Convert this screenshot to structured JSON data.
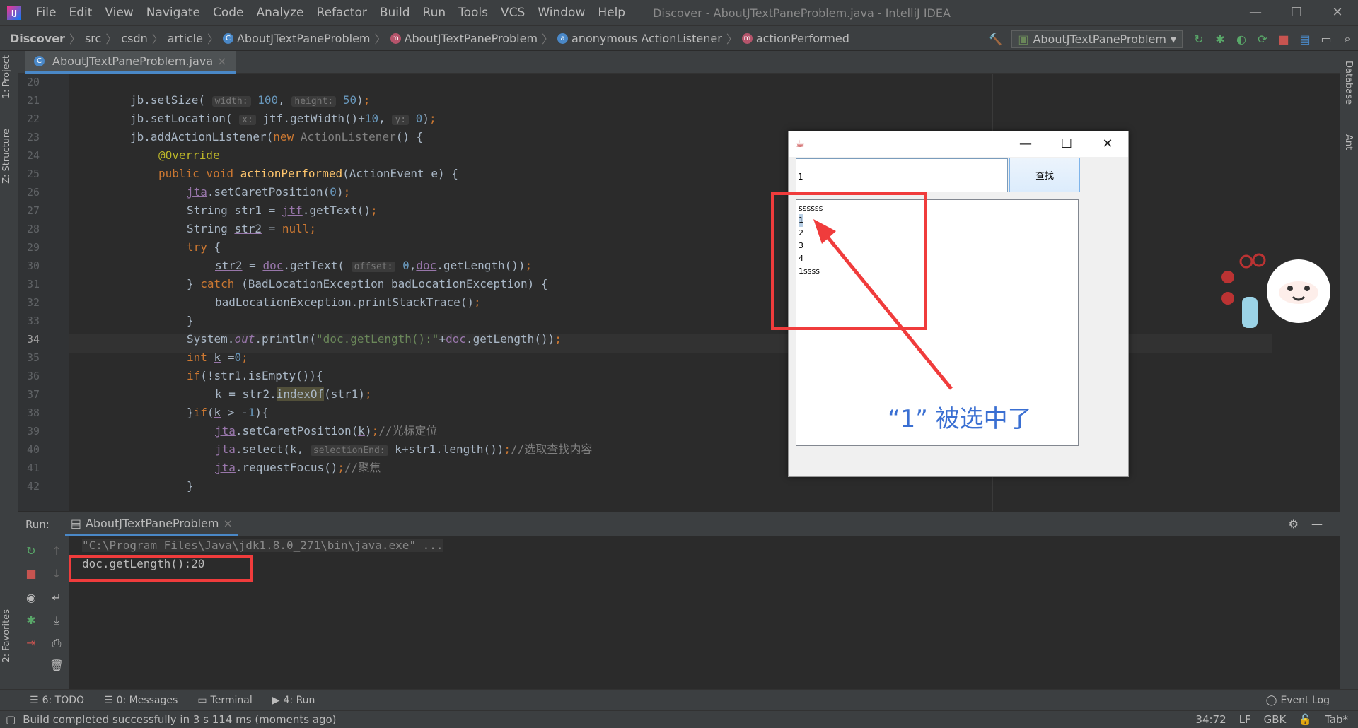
{
  "window": {
    "title": "Discover - AboutJTextPaneProblem.java - IntelliJ IDEA",
    "logo": "IJ",
    "controls": {
      "minimize": "—",
      "maximize": "☐",
      "close": "✕"
    }
  },
  "menu": [
    "File",
    "Edit",
    "View",
    "Navigate",
    "Code",
    "Analyze",
    "Refactor",
    "Build",
    "Run",
    "Tools",
    "VCS",
    "Window",
    "Help"
  ],
  "breadcrumbs": [
    {
      "label": "Discover",
      "icon": ""
    },
    {
      "label": "src",
      "icon": ""
    },
    {
      "label": "csdn",
      "icon": ""
    },
    {
      "label": "article",
      "icon": ""
    },
    {
      "label": "AboutJTextPaneProblem",
      "icon": "C"
    },
    {
      "label": "AboutJTextPaneProblem",
      "icon": "m"
    },
    {
      "label": "anonymous ActionListener",
      "icon": "a"
    },
    {
      "label": "actionPerformed",
      "icon": "m"
    }
  ],
  "toolbar": {
    "run_config": "AboutJTextPaneProblem"
  },
  "left_tabs": {
    "project": "1: Project",
    "structure": "Z: Structure",
    "favorites": "2: Favorites"
  },
  "right_tabs": {
    "database": "Database",
    "ant": "Ant"
  },
  "editor_tab": {
    "label": "AboutJTextPaneProblem.java",
    "close": "×"
  },
  "line_numbers": [
    "20",
    "21",
    "22",
    "23",
    "24",
    "25",
    "26",
    "27",
    "28",
    "29",
    "30",
    "31",
    "32",
    "33",
    "34",
    "35",
    "36",
    "37",
    "38",
    "39",
    "40",
    "41",
    "42"
  ],
  "run_panel": {
    "label": "Run:",
    "tab": "AboutJTextPaneProblem",
    "close": "×",
    "cmd_line": "\"C:\\Program Files\\Java\\jdk1.8.0_271\\bin\\java.exe\" ...",
    "output": "doc.getLength():20"
  },
  "bottom_tabs": [
    {
      "label": "6: TODO",
      "icon": "☰"
    },
    {
      "label": "0: Messages",
      "icon": "☰"
    },
    {
      "label": "Terminal",
      "icon": "▭"
    },
    {
      "label": "4: Run",
      "icon": "▶"
    }
  ],
  "event_log": "Event Log",
  "status": {
    "message": "Build completed successfully in 3 s 114 ms (moments ago)",
    "position": "34:72",
    "line_sep": "LF",
    "encoding": "GBK",
    "indent": "Tab*"
  },
  "swing_app": {
    "field_value": "1",
    "button": "查找",
    "lines": [
      "ssssss",
      "1",
      "2",
      "3",
      "4",
      "1ssss"
    ]
  },
  "annotation": {
    "text": "“1” 被选中了",
    "color": "#3a6fd2",
    "box_color": "#f03c3c"
  }
}
